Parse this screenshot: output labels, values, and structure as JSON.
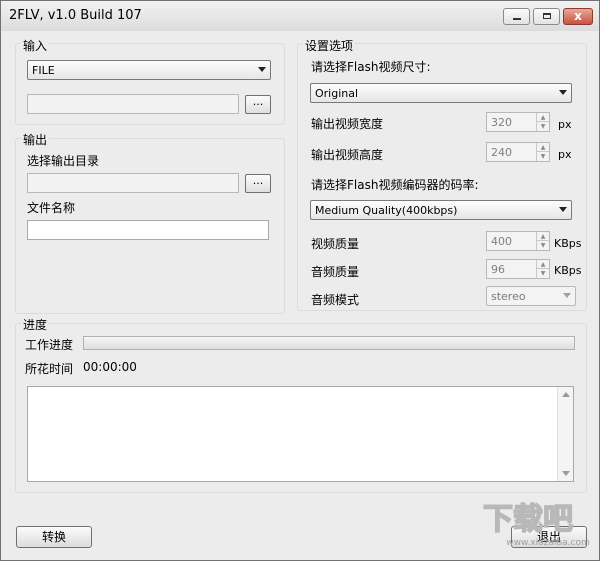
{
  "window": {
    "title": "2FLV, v1.0 Build 107",
    "close_glyph": "x"
  },
  "input_group": {
    "label": "输入",
    "source_select": "FILE",
    "path_value": "",
    "browse_label": "..."
  },
  "output_group": {
    "label": "输出",
    "dir_label": "选择输出目录",
    "dir_value": "",
    "browse_label": "...",
    "filename_label": "文件名称",
    "filename_value": ""
  },
  "settings_group": {
    "label": "设置选项",
    "size_label": "请选择Flash视频尺寸:",
    "size_value": "Original",
    "width_label": "输出视频宽度",
    "width_value": "320",
    "width_unit": "px",
    "height_label": "输出视频高度",
    "height_value": "240",
    "height_unit": "px",
    "bitrate_label": "请选择Flash视频编码器的码率:",
    "bitrate_value": "Medium Quality(400kbps)",
    "video_quality_label": "视频质量",
    "video_quality_value": "400",
    "video_quality_unit": "KBps",
    "audio_quality_label": "音频质量",
    "audio_quality_value": "96",
    "audio_quality_unit": "KBps",
    "audio_mode_label": "音频模式",
    "audio_mode_value": "stereo"
  },
  "progress_group": {
    "label": "进度",
    "work_label": "工作进度",
    "progress": 0,
    "time_label": "所花时间",
    "time_value": "00:00:00",
    "log_text": ""
  },
  "buttons": {
    "convert": "转换",
    "exit": "退出"
  },
  "watermark": {
    "text": "下载吧",
    "url": "www.xiazaiba.com"
  }
}
